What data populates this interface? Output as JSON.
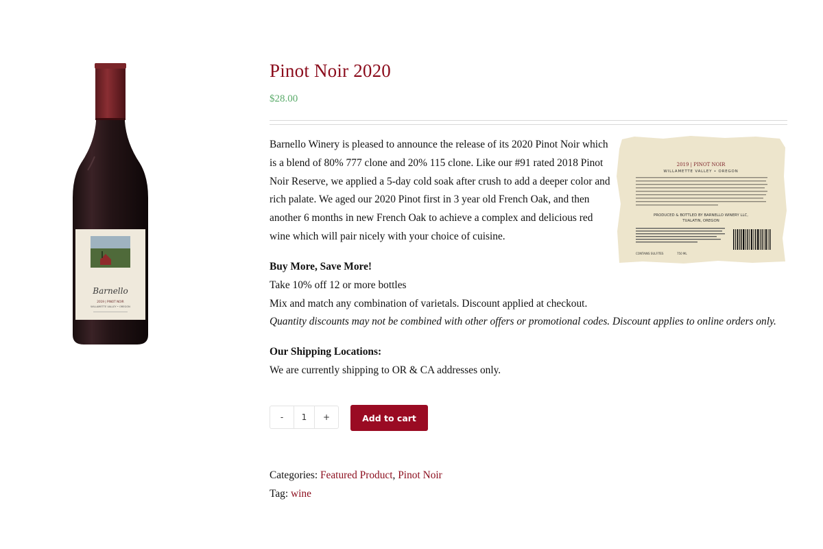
{
  "product": {
    "title": "Pinot Noir 2020",
    "price": "$28.00",
    "description": "Barnello Winery is pleased to announce the release of its 2020 Pinot Noir which is a blend of 80% 777 clone and 20% 115 clone. Like our #91 rated 2018 Pinot Noir Reserve, we applied a 5-day cold soak after crush to add a deeper color and rich palate. We aged our 2020 Pinot first in 3 year old French Oak, and then another 6 months in new French Oak to achieve a complex and delicious red wine which will pair nicely with your choice of cuisine."
  },
  "bottle_label": {
    "brand": "Barnello",
    "vintage_line": "2019 | PINOT NOIR",
    "region": "WILLAMETTE VALLEY • OREGON"
  },
  "back_label": {
    "vintage_line": "2019 | PINOT NOIR",
    "region": "WILLAMETTE VALLEY • OREGON",
    "producer": "PRODUCED & BOTTLED BY BARNELLO WINERY LLC,",
    "location": "TUALATIN, OREGON",
    "sulfites": "CONTAINS SULFITES",
    "volume": "750 ML"
  },
  "promo": {
    "heading": "Buy More, Save More!",
    "line1": "Take 10% off 12 or more bottles",
    "line2": "Mix and match any combination of varietals. Discount applied at checkout.",
    "note": "Quantity discounts may not be combined with other offers or promotional codes. Discount applies to online orders only."
  },
  "shipping": {
    "heading": "Our Shipping Locations:",
    "text": "We are currently shipping to OR & CA addresses only."
  },
  "cart": {
    "minus": "-",
    "quantity": "1",
    "plus": "+",
    "add_label": "Add to cart"
  },
  "meta": {
    "categories_label": "Categories:",
    "categories": [
      "Featured Product",
      "Pinot Noir"
    ],
    "separator": ",",
    "tag_label": "Tag:",
    "tag": "wine"
  },
  "colors": {
    "accent": "#8b0c1c",
    "button": "#9a0b23",
    "price": "#5aab6a"
  }
}
